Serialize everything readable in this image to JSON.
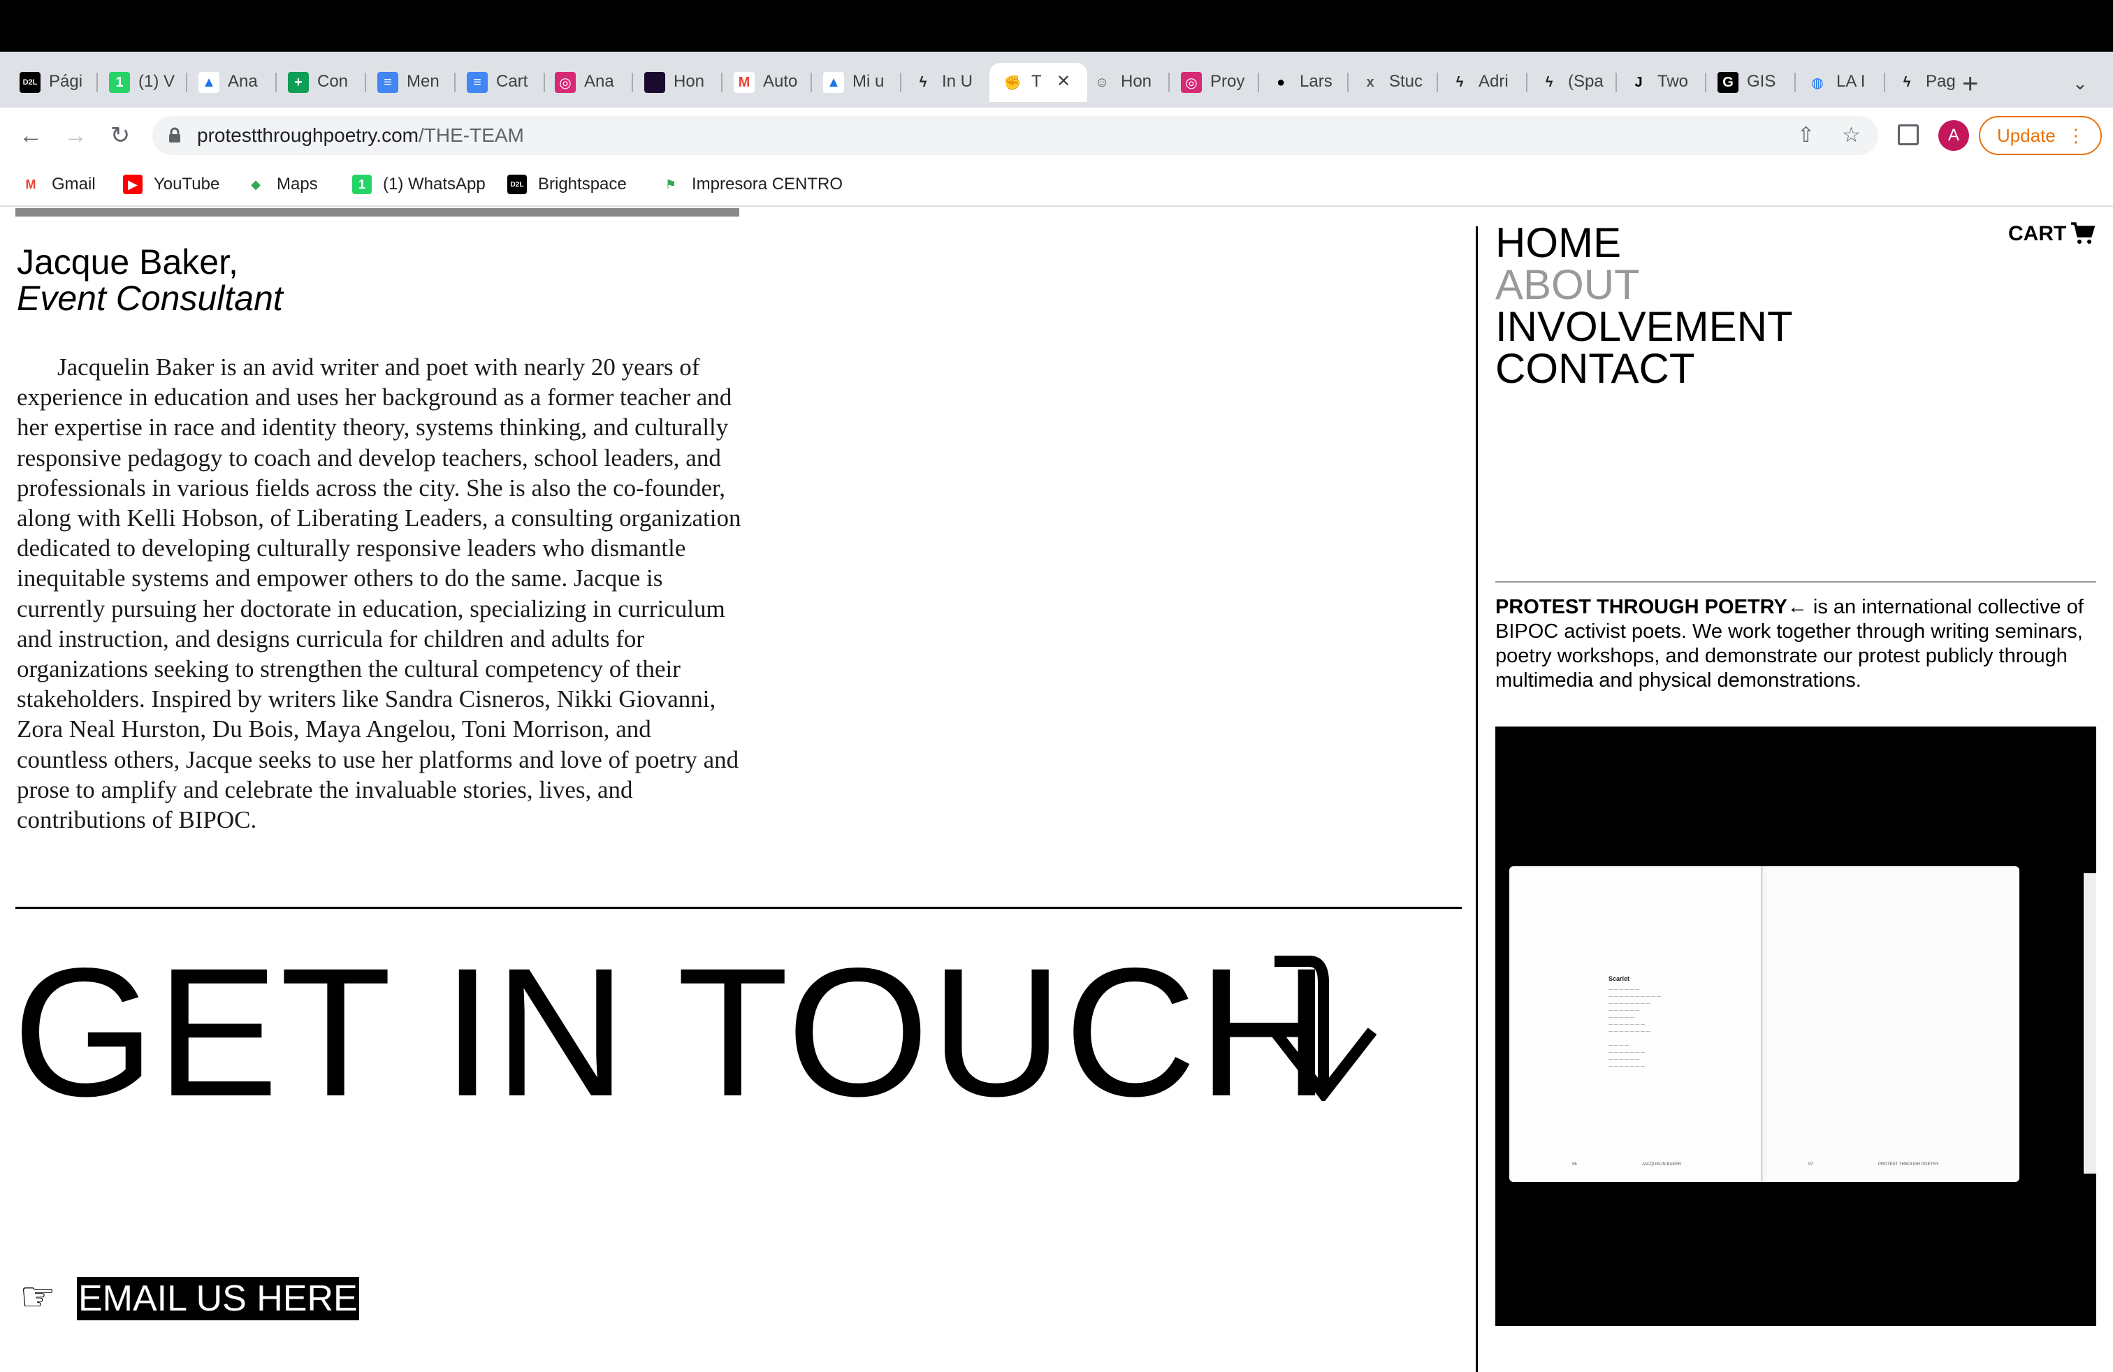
{
  "browser": {
    "tabs": [
      {
        "label": "Pági",
        "icon": "d2l-icon"
      },
      {
        "label": "(1) V",
        "icon": "whatsapp-icon"
      },
      {
        "label": "Ana",
        "icon": "google-drive-icon"
      },
      {
        "label": "Con",
        "icon": "google-sheets-icon"
      },
      {
        "label": "Men",
        "icon": "google-docs-icon"
      },
      {
        "label": "Cart",
        "icon": "google-docs-icon"
      },
      {
        "label": "Ana",
        "icon": "instagram-icon"
      },
      {
        "label": "Hon",
        "icon": "circle-icon"
      },
      {
        "label": "Auto",
        "icon": "gmail-icon"
      },
      {
        "label": "Mi u",
        "icon": "google-drive-icon"
      },
      {
        "label": "In U",
        "icon": "bolt-icon"
      },
      {
        "label": "T",
        "icon": "hand-emoji-icon",
        "active": true
      },
      {
        "label": "Hon",
        "icon": "smiley-icon"
      },
      {
        "label": "Proy",
        "icon": "instagram-icon"
      },
      {
        "label": "Lars",
        "icon": "black-circle-icon"
      },
      {
        "label": "Stuc",
        "icon": "x-icon"
      },
      {
        "label": "Adri",
        "icon": "bolt-icon"
      },
      {
        "label": "(Spa",
        "icon": "bolt-icon"
      },
      {
        "label": "Two",
        "icon": "j-icon"
      },
      {
        "label": "GIS",
        "icon": "gis-icon"
      },
      {
        "label": "LA I",
        "icon": "globe-icon"
      },
      {
        "label": "Pag",
        "icon": "bolt-icon"
      }
    ],
    "url_domain": "protestthroughpoetry.com",
    "url_path": "/THE-TEAM",
    "avatar_letter": "A",
    "update_label": "Update",
    "bookmarks": [
      {
        "label": "Gmail",
        "icon": "gmail-icon"
      },
      {
        "label": "YouTube",
        "icon": "youtube-icon"
      },
      {
        "label": "Maps",
        "icon": "maps-icon"
      },
      {
        "label": "(1) WhatsApp",
        "icon": "whatsapp-icon"
      },
      {
        "label": "Brightspace",
        "icon": "d2l-icon"
      },
      {
        "label": "Impresora CENTRO",
        "icon": "flag-icon"
      }
    ]
  },
  "profile": {
    "name": "Jacque Baker,",
    "role": "Event Consultant",
    "bio": "Jacquelin Baker is an avid writer and poet with nearly 20 years of experience in education and uses her background as a former teacher and her expertise in race and identity theory, systems thinking, and culturally responsive pedagogy to coach and develop teachers, school leaders, and professionals in various fields across the city. She is also the co-founder, along with Kelli Hobson, of Liberating Leaders, a consulting organization dedicated to developing culturally responsive leaders who dismantle inequitable systems and empower others to do the same. Jacque is currently pursuing her doctorate in education, specializing in curriculum and instruction, and designs curricula for children and adults for organizations seeking to strengthen the cultural competency of their stakeholders. Inspired by writers like Sandra Cisneros, Nikki Giovanni, Zora Neal Hurston, Du Bois, Maya Angelou, Toni Morrison, and countless others, Jacque seeks to use her platforms and love of poetry and prose to amplify and celebrate the invaluable stories, lives, and contributions of BIPOC."
  },
  "contact": {
    "heading": "GET IN TOUCH",
    "hand": "☞",
    "email_label": "EMAIL US HERE"
  },
  "nav": {
    "home": "HOME",
    "about": "ABOUT",
    "involvement": "INVOLVEMENT",
    "contact": "CONTACT",
    "cart": "CART"
  },
  "intro": {
    "brand": "PROTEST THROUGH POETRY",
    "arrow": "←",
    "text": " is an international collective of BIPOC activist poets. We work together through writing seminars, poetry workshops, and demonstrate our protest publicly through multimedia and physical demonstrations."
  },
  "book": {
    "poem_title": "Scarlet",
    "left_footer": "JACQUELIN BAKER",
    "right_footer": "PROTEST THROUGH POETRY",
    "left_page_no": "96",
    "right_page_no": "97"
  }
}
